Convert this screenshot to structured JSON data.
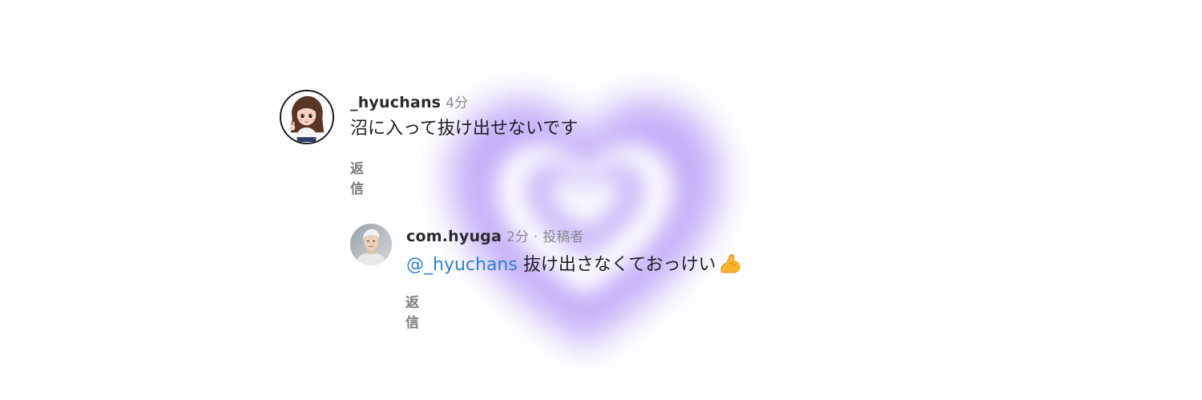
{
  "comments": [
    {
      "username": "_hyuchans",
      "timestamp": "4分",
      "text": "沼に入って抜け出せないです",
      "reply_label": "返信",
      "avatar_icon": "cartoon-girl-avatar-icon"
    },
    {
      "username": "com.hyuga",
      "timestamp": "2分",
      "separator": "·",
      "author_tag": "投稿者",
      "mention": "@_hyuchans",
      "text": "抜け出さなくておっけい",
      "emoji_icon": "flexed-biceps-icon",
      "reply_label": "返信",
      "avatar_icon": "user-photo-avatar-icon"
    }
  ],
  "colors": {
    "heart_glow": "#b59cf5",
    "mention": "#2c7fd6",
    "muted_text": "#8a8a8e",
    "reply_label": "#7b7b80"
  }
}
